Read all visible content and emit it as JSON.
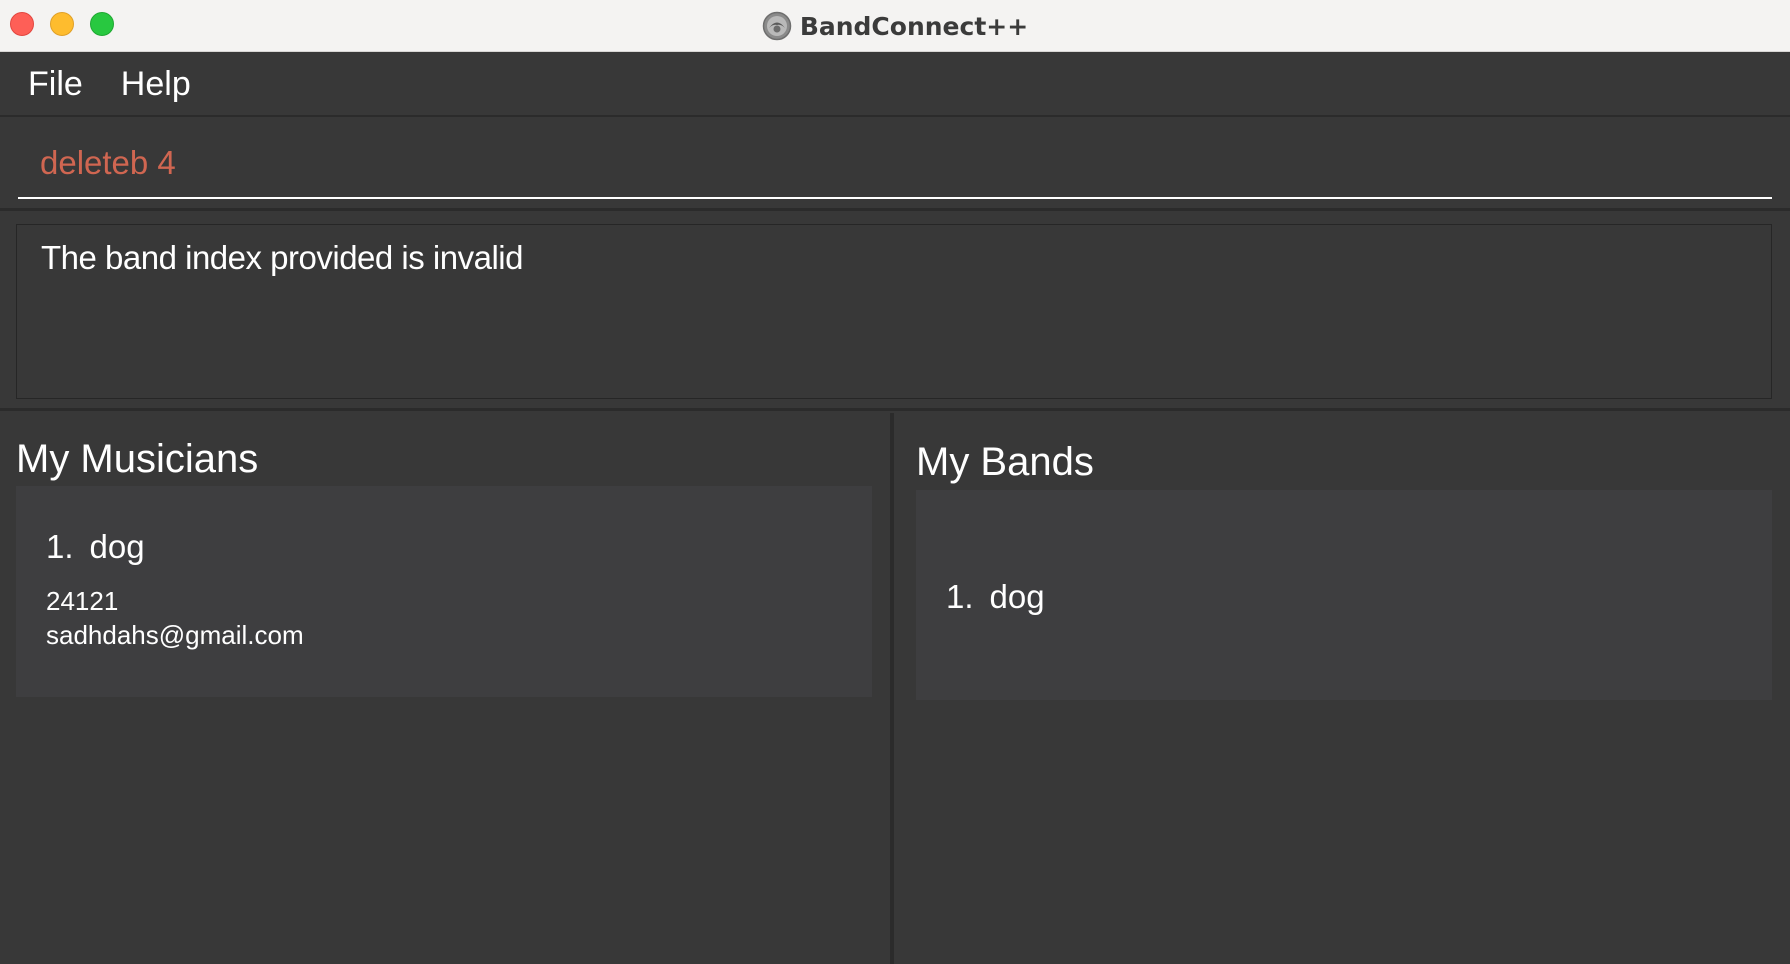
{
  "window": {
    "title": "BandConnect++",
    "app_icon": "app-logo-icon"
  },
  "menu": {
    "items": [
      {
        "label": "File"
      },
      {
        "label": "Help"
      }
    ]
  },
  "command": {
    "value": "deleteb 4",
    "text_color": "#d06651"
  },
  "result": {
    "message": "The band index provided is invalid"
  },
  "musicians": {
    "title": "My Musicians",
    "items": [
      {
        "index": "1.",
        "name": "dog",
        "phone": "24121",
        "email": "sadhdahs@gmail.com"
      }
    ]
  },
  "bands": {
    "title": "My Bands",
    "items": [
      {
        "index": "1.",
        "name": "dog"
      }
    ]
  },
  "colors": {
    "background": "#383838",
    "card": "#3e3e40",
    "close": "#fe5f57",
    "minimize": "#febc2e",
    "zoom": "#28c840"
  }
}
